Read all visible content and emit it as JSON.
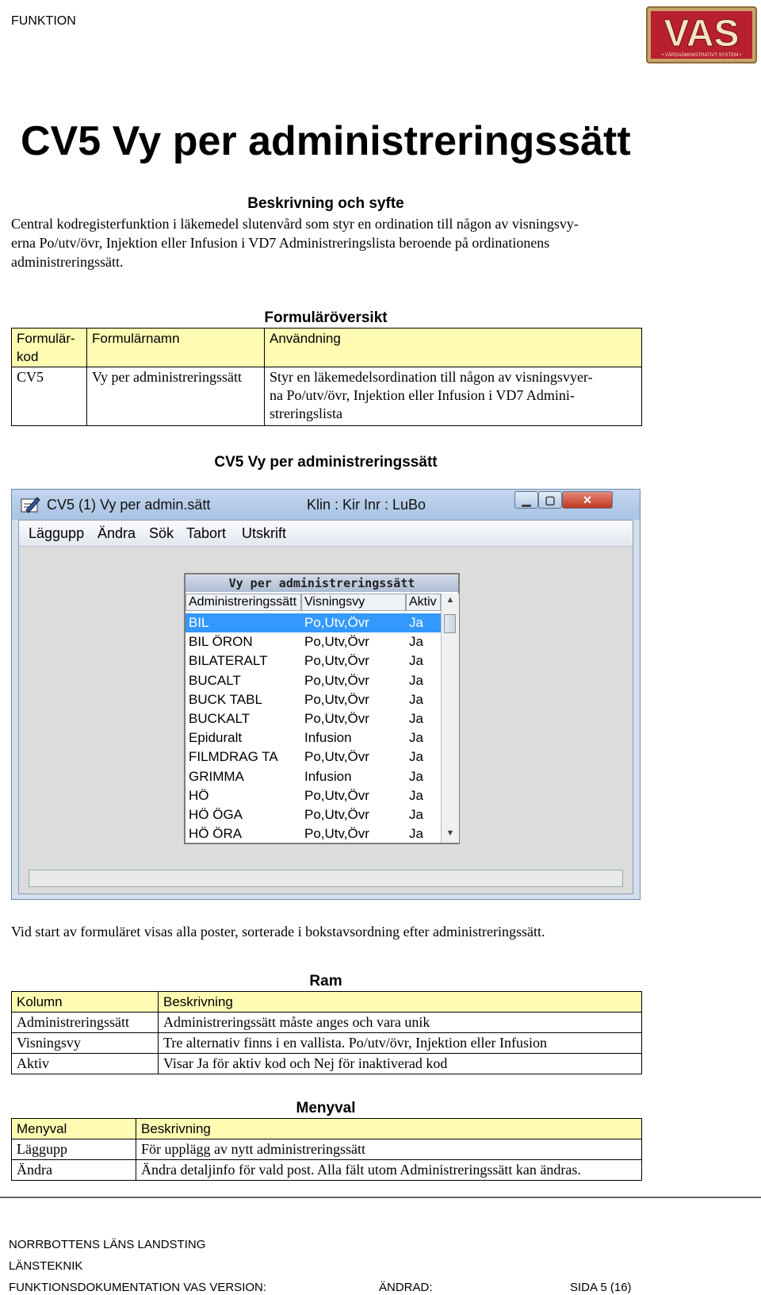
{
  "header": {
    "label": "FUNKTION",
    "logo_text": "VAS",
    "logo_subtext": "• VÅRDADMINISTRATIVT SYSTEM •",
    "logo_color": "#b8202e"
  },
  "title": "CV5 Vy per administreringssätt",
  "description": {
    "heading": "Beskrivning och syfte",
    "lines": [
      "Central kodregisterfunktion i läkemedel slutenvård som styr en ordination till någon av visningsvy-",
      "erna Po/utv/övr, Injektion eller Infusion i VD7 Administreringslista beroende på ordinationens",
      "administreringssätt."
    ]
  },
  "overview": {
    "heading": "Formuläröversikt",
    "headers": [
      "Formulär-kod",
      "Formulärnamn",
      "Användning"
    ],
    "rows": [
      {
        "code": "CV5",
        "name": "Vy per administreringssätt",
        "usage_lines": [
          "Styr en läkemedelsordination till någon av visningsvyer-",
          "na Po/utv/övr, Injektion eller Infusion i VD7 Admini-",
          "streringslista"
        ]
      }
    ]
  },
  "figure_heading": "CV5 Vy per administreringssätt",
  "window": {
    "title": "CV5 (1) Vy per admin.sätt",
    "context": "Klin : Kir  Inr : LuBo",
    "menu": [
      "Läggupp",
      "Ändra",
      "Sök",
      "Tabort",
      "Utskrift"
    ],
    "grid": {
      "title": "Vy per administreringssätt",
      "columns": [
        "Administreringssätt",
        "Visningsvy",
        "Aktiv"
      ],
      "rows": [
        [
          "BIL",
          "Po,Utv,Övr",
          "Ja"
        ],
        [
          "BIL ÖRON",
          "Po,Utv,Övr",
          "Ja"
        ],
        [
          "BILATERALT",
          "Po,Utv,Övr",
          "Ja"
        ],
        [
          "BUCALT",
          "Po,Utv,Övr",
          "Ja"
        ],
        [
          "BUCK TABL",
          "Po,Utv,Övr",
          "Ja"
        ],
        [
          "BUCKALT",
          "Po,Utv,Övr",
          "Ja"
        ],
        [
          "Epiduralt",
          "Infusion",
          "Ja"
        ],
        [
          "FILMDRAG TA",
          "Po,Utv,Övr",
          "Ja"
        ],
        [
          "GRIMMA",
          "Infusion",
          "Ja"
        ],
        [
          "HÖ",
          "Po,Utv,Övr",
          "Ja"
        ],
        [
          "HÖ ÖGA",
          "Po,Utv,Övr",
          "Ja"
        ],
        [
          "HÖ ÖRA",
          "Po,Utv,Övr",
          "Ja"
        ]
      ],
      "selected_index": 0
    }
  },
  "note": "Vid start av formuläret visas alla poster, sorterade i bokstavsordning efter administreringssätt.",
  "ram": {
    "heading": "Ram",
    "headers": [
      "Kolumn",
      "Beskrivning"
    ],
    "rows": [
      [
        "Administreringssätt",
        "Administreringssätt måste anges och vara unik"
      ],
      [
        "Visningsvy",
        "Tre alternativ finns i en vallista. Po/utv/övr, Injektion eller Infusion"
      ],
      [
        "Aktiv",
        "Visar Ja för aktiv kod och Nej för inaktiverad kod"
      ]
    ]
  },
  "menyval": {
    "heading": "Menyval",
    "headers": [
      "Menyval",
      "Beskrivning"
    ],
    "rows": [
      [
        "Läggupp",
        "För upplägg av nytt administreringssätt"
      ],
      [
        "Ändra",
        "Ändra detaljinfo för vald post. Alla fält utom Administreringssätt kan ändras."
      ]
    ]
  },
  "footer": {
    "org": "NORRBOTTENS LÄNS LANDSTING",
    "dept": "LÄNSTEKNIK",
    "doc": "FUNKTIONSDOKUMENTATION VAS VERSION:",
    "changed": "ÄNDRAD:",
    "page": "SIDA 5 (16)"
  }
}
